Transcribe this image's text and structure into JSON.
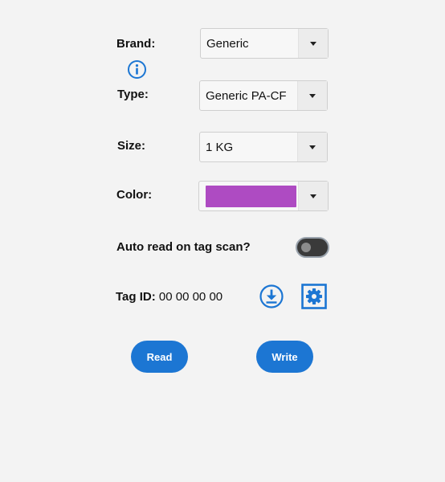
{
  "colors": {
    "accent": "#1c76d3",
    "selected_color": "#ae4bc2",
    "toggle_track": "#3a3a3a"
  },
  "brand": {
    "label": "Brand:",
    "value": "Generic",
    "info_icon": "info-icon"
  },
  "type": {
    "label": "Type:",
    "value": "Generic PA-CF"
  },
  "size": {
    "label": "Size:",
    "value": "1 KG"
  },
  "color": {
    "label": "Color:"
  },
  "auto_read": {
    "label": "Auto read on tag scan?",
    "enabled": false
  },
  "tag": {
    "label": "Tag ID:",
    "value": "00 00 00 00",
    "download_icon": "download-icon",
    "settings_icon": "settings-icon"
  },
  "actions": {
    "read_label": "Read",
    "write_label": "Write"
  }
}
